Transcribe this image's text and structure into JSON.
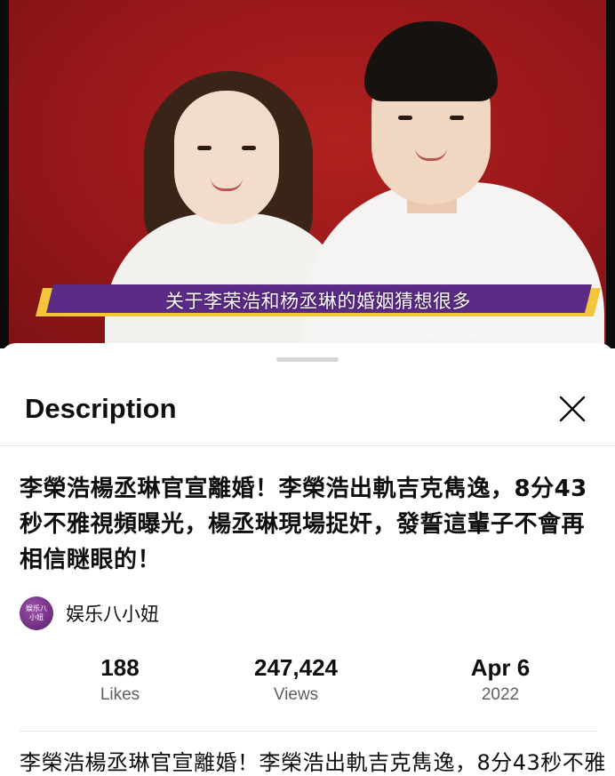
{
  "video": {
    "caption": "关于李荣浩和杨丞琳的婚姻猜想很多",
    "watermark": "娱乐八小妞"
  },
  "sheet": {
    "title": "Description",
    "close_icon": "close-icon"
  },
  "description": {
    "video_title": "李榮浩楊丞琳官宣離婚！李榮浩出軌吉克雋逸，8分43秒不雅視頻曝光，楊丞琳現場捉奸，發誓這輩子不會再相信瞇眼的！",
    "body_start": "李榮浩楊丞琳官宣離婚！李榮浩出軌吉克雋逸，8分43秒不雅"
  },
  "channel": {
    "name": "娱乐八小妞",
    "avatar_text": "娱乐八小妞"
  },
  "stats": {
    "likes": {
      "value": "188",
      "label": "Likes"
    },
    "views": {
      "value": "247,424",
      "label": "Views"
    },
    "date": {
      "value": "Apr 6",
      "label": "2022"
    }
  }
}
